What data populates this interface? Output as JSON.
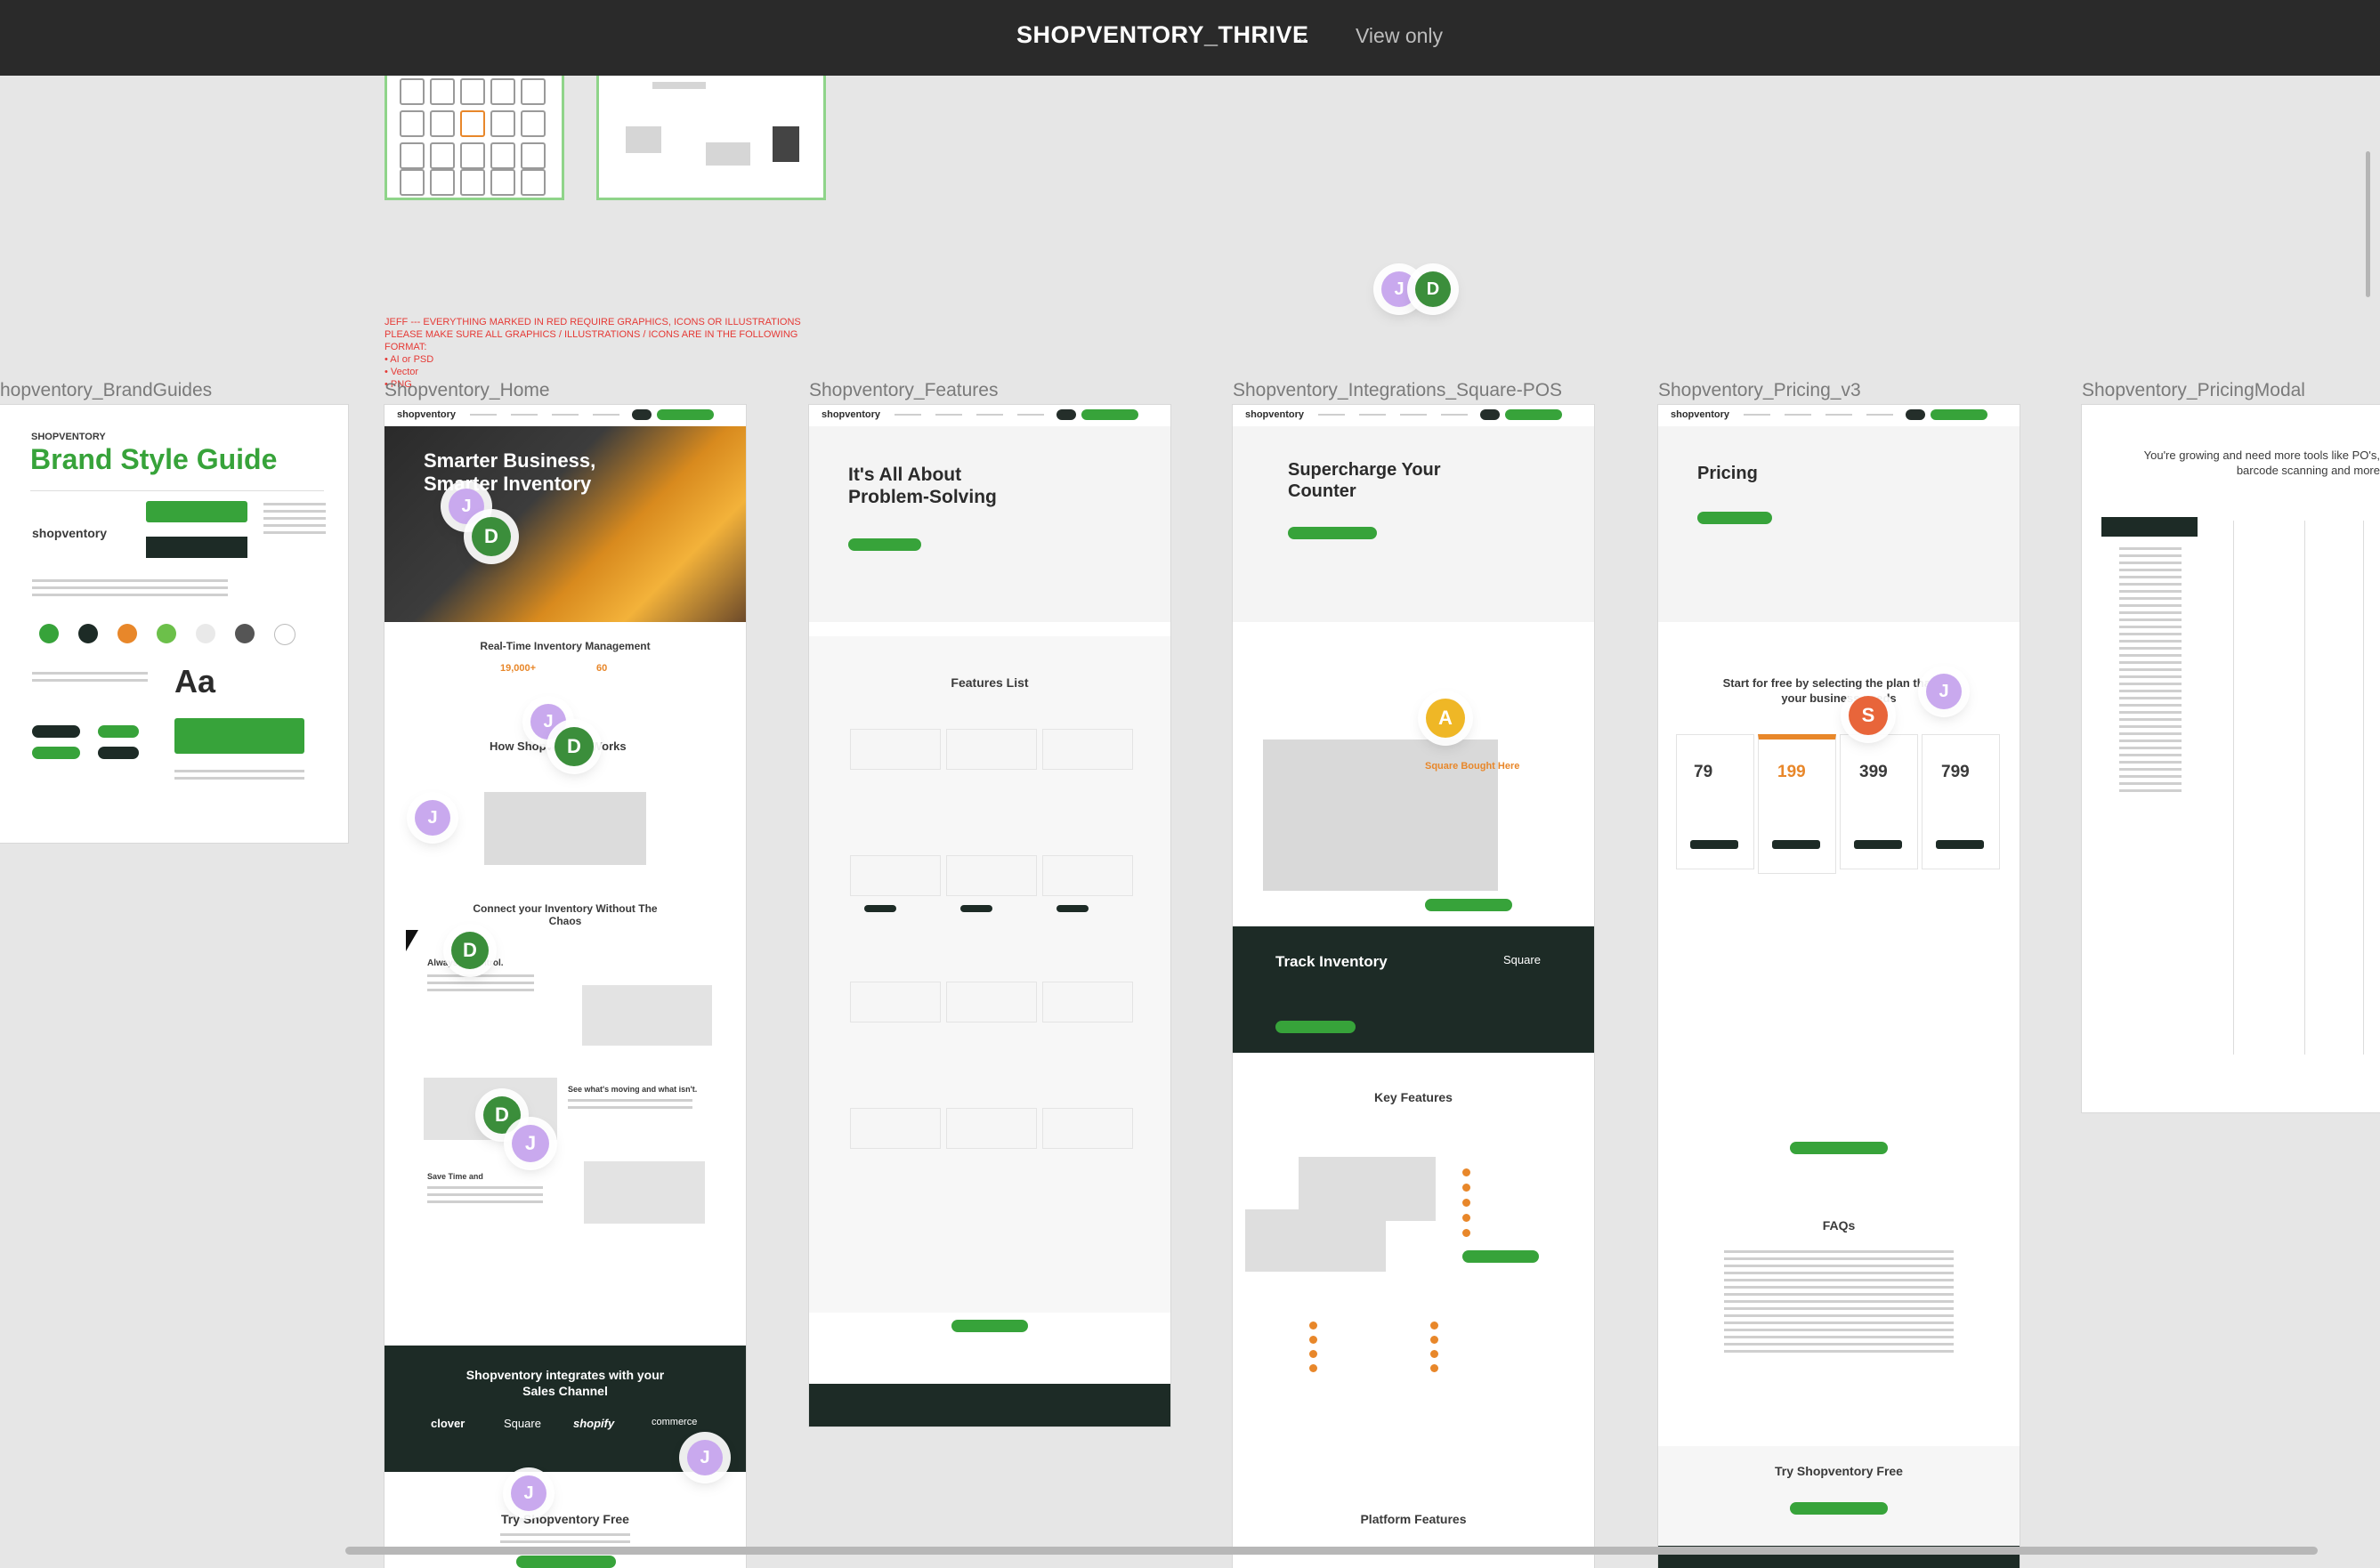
{
  "header": {
    "file_title": "SHOPVENTORY_THRIVE",
    "view_mode": "View only"
  },
  "note": {
    "line1": "JEFF --- EVERYTHING MARKED IN RED REQUIRE GRAPHICS, ICONS OR ILLUSTRATIONS",
    "line2": "PLEASE MAKE SURE ALL GRAPHICS / ILLUSTRATIONS / ICONS ARE IN THE FOLLOWING FORMAT:",
    "bullets": [
      "• AI or PSD",
      "• Vector",
      "• PNG"
    ]
  },
  "frames": {
    "brand": {
      "label": "hopventory_BrandGuides",
      "brand_small": "SHOPVENTORY",
      "title": "Brand Style Guide",
      "logo_text": "shopventory",
      "aa": "Aa"
    },
    "home": {
      "label": "Shopventory_Home",
      "hero_title": "Smarter Business, Smarter Inventory",
      "realtime": "Real-Time Inventory Management",
      "stat1": "19,000+",
      "stat2": "60",
      "how": "How Shopventory Works",
      "connect": "Connect your Inventory Without The Chaos",
      "always": "Always in control.",
      "see": "See what's moving and what isn't.",
      "save": "Save Time and",
      "integrates": "Shopventory integrates with your Sales Channel",
      "partners": [
        "clover",
        "Square",
        "shopify",
        "commerce"
      ],
      "try_free": "Try Shopventory Free"
    },
    "features": {
      "label": "Shopventory_Features",
      "hero": "It's All About Problem-Solving",
      "list_title": "Features List"
    },
    "integrations": {
      "label": "Shopventory_Integrations_Square-POS",
      "hero": "Supercharge Your Counter",
      "bought": "Square Bought Here",
      "track": "Track Inventory",
      "square": "Square",
      "key_features": "Key Features",
      "platform": "Platform Features"
    },
    "pricing": {
      "label": "Shopventory_Pricing_v3",
      "title": "Pricing",
      "start": "Start for free by selecting the plan that fits your business needs",
      "prices": [
        "79",
        "199",
        "399",
        "799"
      ],
      "faqs": "FAQs",
      "try_free": "Try Shopventory Free"
    },
    "modal": {
      "label": "Shopventory_PricingModal",
      "headline": "You're growing and need more tools like PO's, barcode scanning and more"
    }
  },
  "avatars": {
    "j": "J",
    "d": "D",
    "a": "A",
    "s": "S"
  },
  "colors": {
    "topbar": "#2a2a2a",
    "canvas": "#e6e6e6",
    "brand_green": "#37a33a",
    "brand_dark": "#1d2b26",
    "accent_orange": "#e8872a",
    "avatar_j": "#c9a9ee",
    "avatar_d": "#3b8e3b",
    "avatar_a": "#efb726",
    "avatar_s": "#e8653a"
  }
}
